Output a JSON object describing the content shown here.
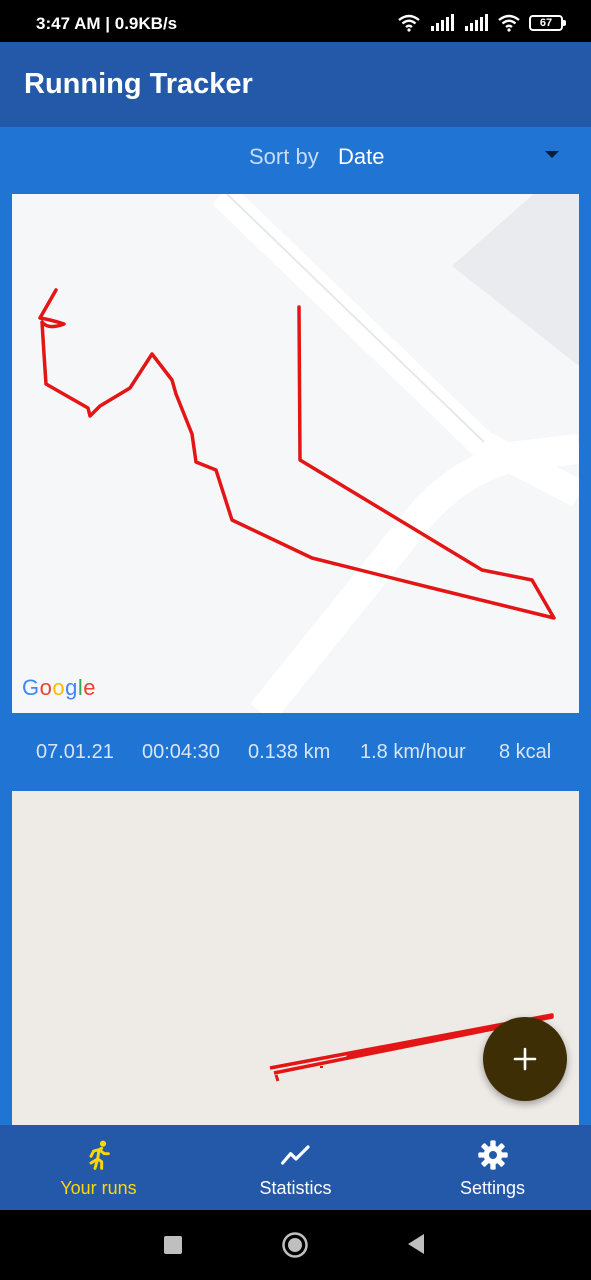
{
  "status_bar": {
    "time": "3:47 AM | 0.9KB/s",
    "battery": "67"
  },
  "app_bar": {
    "title": "Running Tracker"
  },
  "sort": {
    "label": "Sort by",
    "value": "Date"
  },
  "runs": [
    {
      "date": "07.01.21",
      "duration": "00:04:30",
      "distance": "0.138 km",
      "speed": "1.8 km/hour",
      "calories": "8 kcal",
      "map_attribution": "Google"
    }
  ],
  "fab": {
    "icon": "plus-icon"
  },
  "bottom_nav": {
    "items": [
      {
        "label": "Your runs",
        "icon": "runner-icon",
        "active": true
      },
      {
        "label": "Statistics",
        "icon": "trending-up-icon",
        "active": false
      },
      {
        "label": "Settings",
        "icon": "gear-icon",
        "active": false
      }
    ]
  },
  "colors": {
    "app_bar": "#2459aa",
    "background": "#1f74d4",
    "active_nav": "#ffd700",
    "route": "#e31515",
    "fab": "#3e2e05"
  },
  "system_nav": {
    "icons": [
      "recents-icon",
      "home-icon",
      "back-icon"
    ]
  }
}
